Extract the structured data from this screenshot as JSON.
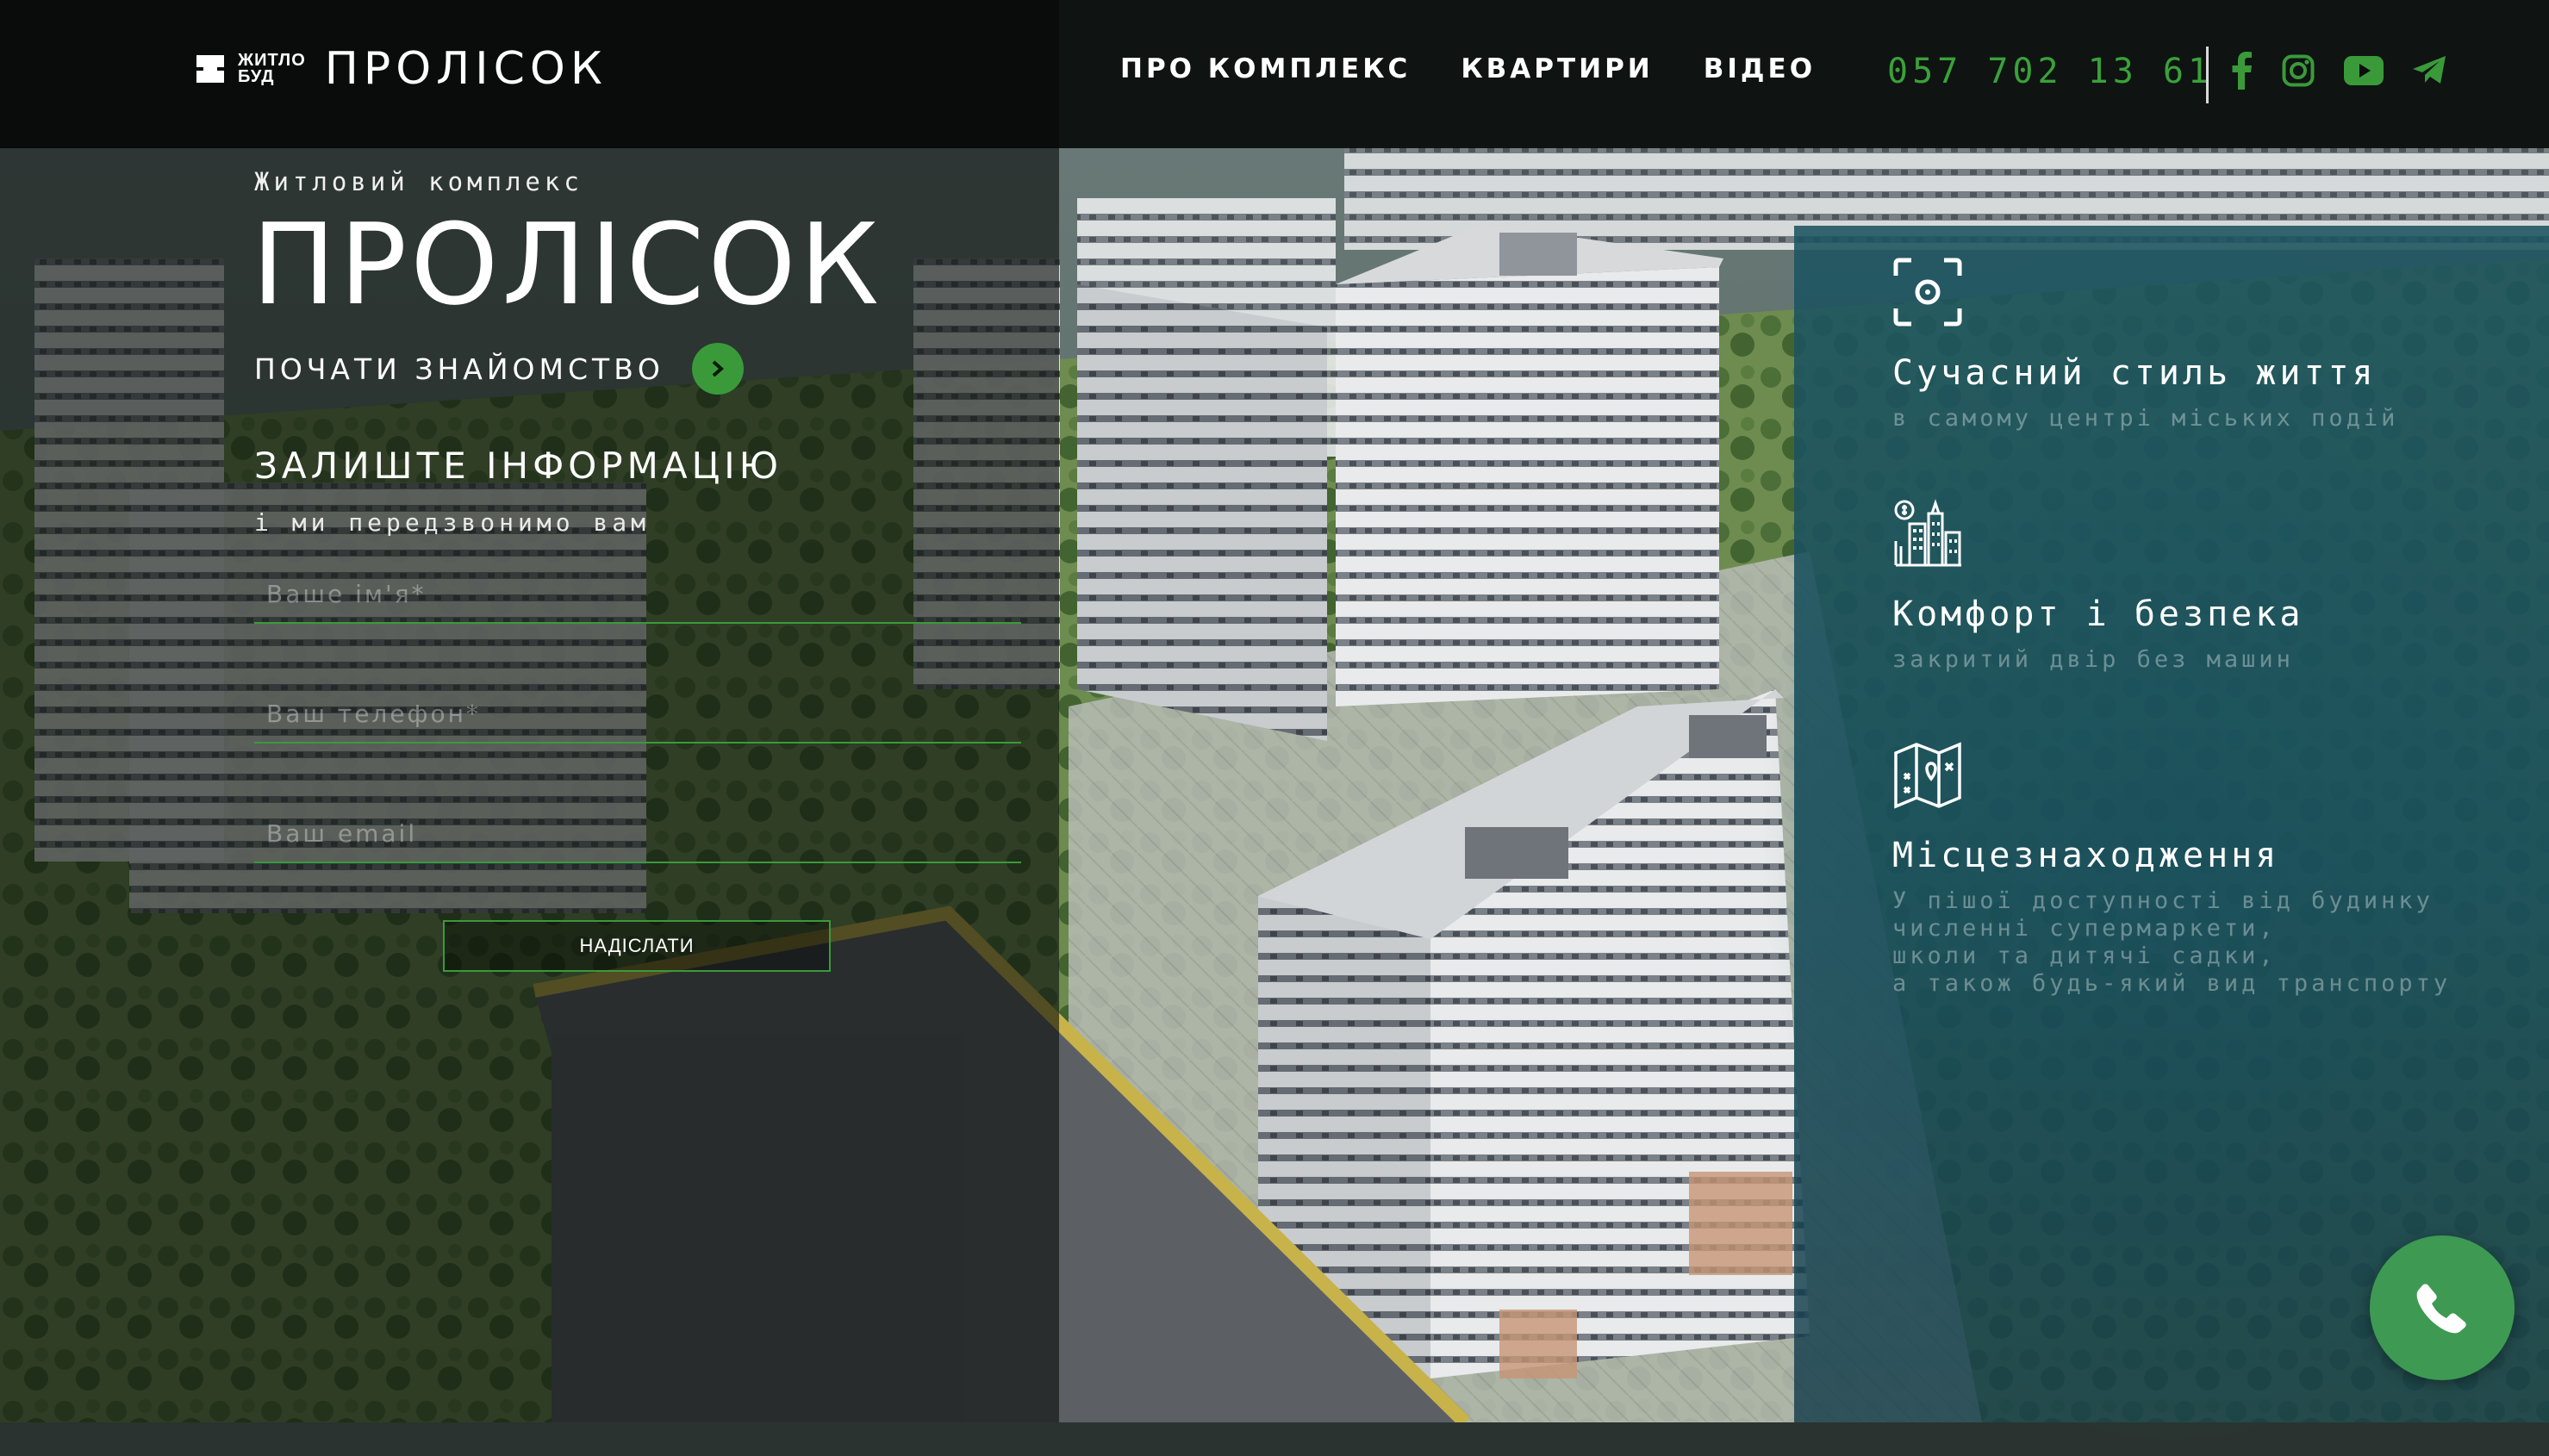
{
  "header": {
    "logo_brand_line1": "ЖИТЛО",
    "logo_brand_line2": "БУД",
    "logo_title": "ПРОЛІСОК",
    "nav": [
      {
        "label": "ПРО КОМПЛЕКС"
      },
      {
        "label": "КВАРТИРИ"
      },
      {
        "label": "ВІДЕО"
      }
    ],
    "phone": "057 702 13 61",
    "socials": [
      "facebook-icon",
      "instagram-icon",
      "youtube-icon",
      "telegram-icon"
    ]
  },
  "hero": {
    "subtitle": "Житловий комплекс",
    "title": "ПРОЛІСОК",
    "start_label": "ПОЧАТИ ЗНАЙОМСТВО"
  },
  "form": {
    "title": "ЗАЛИШТЕ ІНФОРМАЦІЮ",
    "subtitle": "і ми передзвонимо вам",
    "name_placeholder": "Ваше ім'я*",
    "phone_placeholder": "Ваш телефон*",
    "email_placeholder": "Ваш email",
    "submit_label": "НАДІСЛАТИ"
  },
  "features": [
    {
      "title": "Сучасний стиль життя",
      "desc": [
        "в самому центрі міських подій"
      ],
      "icon": "focus-target-icon"
    },
    {
      "title": "Комфорт і безпека",
      "desc": [
        "закритий двір без машин"
      ],
      "icon": "city-buildings-icon"
    },
    {
      "title": "Місцезнаходження",
      "desc": [
        "У пішої доступності від будинку",
        "численні супермаркети,",
        "школи та дитячі садки,",
        "а також будь-який вид транспорту"
      ],
      "icon": "map-icon"
    }
  ],
  "colors": {
    "accent_green": "#3a9a3a",
    "phone_green": "#3aa13a",
    "panel_teal": "#1c5460",
    "call_button": "#3e9a53"
  }
}
